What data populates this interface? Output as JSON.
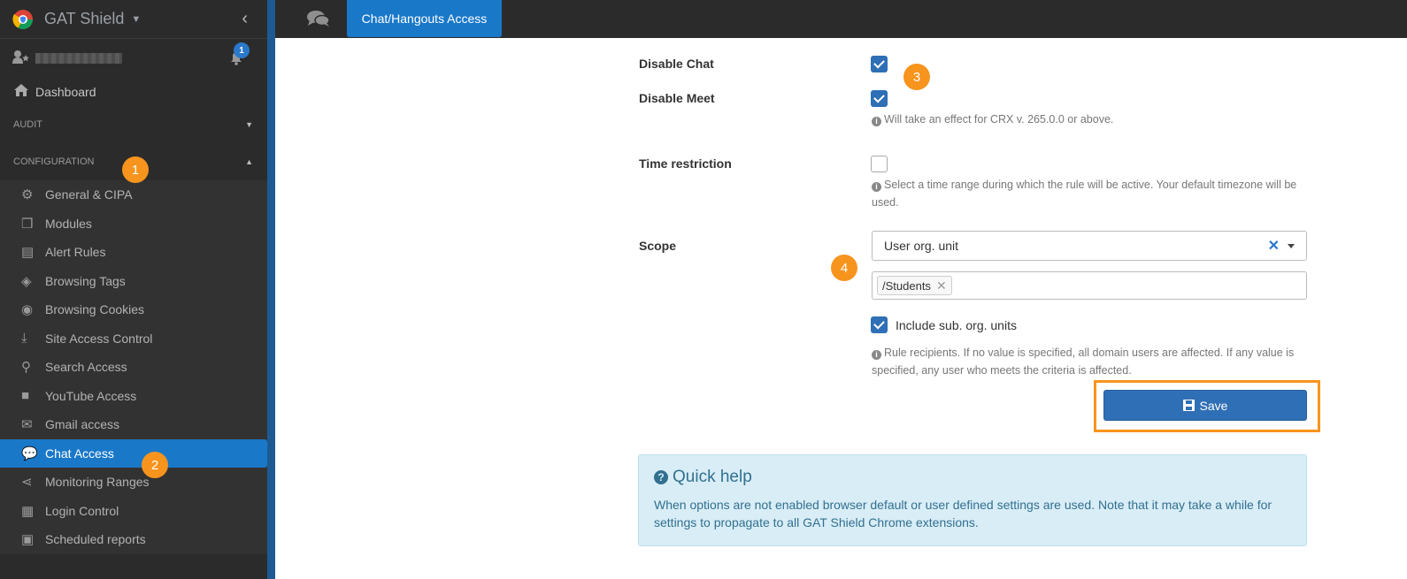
{
  "brand": {
    "name": "GAT Shield"
  },
  "user": {
    "notifications": "1"
  },
  "sidebar": {
    "dashboard": "Dashboard",
    "audit": "AUDIT",
    "configuration": "CONFIGURATION",
    "items": [
      {
        "label": "General & CIPA",
        "icon": "gears-icon"
      },
      {
        "label": "Modules",
        "icon": "cubes-icon"
      },
      {
        "label": "Alert Rules",
        "icon": "document-icon"
      },
      {
        "label": "Browsing Tags",
        "icon": "tags-icon"
      },
      {
        "label": "Browsing Cookies",
        "icon": "cookie-icon"
      },
      {
        "label": "Site Access Control",
        "icon": "download-icon"
      },
      {
        "label": "Search Access",
        "icon": "search-gear-icon"
      },
      {
        "label": "YouTube Access",
        "icon": "video-icon"
      },
      {
        "label": "Gmail access",
        "icon": "envelope-icon"
      },
      {
        "label": "Chat Access",
        "icon": "chat-icon"
      },
      {
        "label": "Monitoring Ranges",
        "icon": "share-icon"
      },
      {
        "label": "Login Control",
        "icon": "building-icon"
      },
      {
        "label": "Scheduled reports",
        "icon": "calendar-icon"
      }
    ]
  },
  "topbar": {
    "tab": "Chat/Hangouts Access"
  },
  "callouts": {
    "c1": "1",
    "c2": "2",
    "c3": "3",
    "c4": "4"
  },
  "form": {
    "disable_chat": "Disable Chat",
    "disable_meet": "Disable Meet",
    "meet_hint": "Will take an effect for CRX v. 265.0.0 or above.",
    "time_restriction": "Time restriction",
    "time_hint": "Select a time range during which the rule will be active. Your default timezone will be used.",
    "scope": "Scope",
    "scope_value": "User org. unit",
    "scope_tag": "/Students",
    "include_sub": "Include sub. org. units",
    "scope_hint": "Rule recipients. If no value is specified, all domain users are affected. If any value is specified, any user who meets the criteria is affected.",
    "save": "Save"
  },
  "help": {
    "title": "Quick help",
    "body": "When options are not enabled browser default or user defined settings are used. Note that it may take a while for settings to propagate to all GAT Shield Chrome extensions."
  },
  "colors": {
    "accent": "#1a78c9",
    "callout": "#f7941d",
    "help_bg": "#d9edf7"
  }
}
